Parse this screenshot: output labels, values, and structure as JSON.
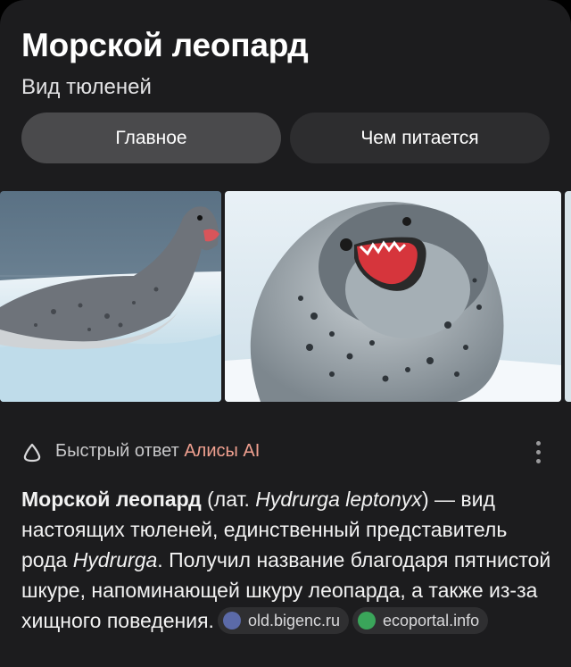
{
  "header": {
    "title": "Морской леопард",
    "subtitle": "Вид тюленей"
  },
  "tabs": [
    {
      "label": "Главное",
      "active": true
    },
    {
      "label": "Чем питается",
      "active": false
    }
  ],
  "gallery": {
    "images": [
      "leopard-seal-on-ice-profile",
      "leopard-seal-open-mouth-closeup"
    ]
  },
  "alice": {
    "label_prefix": "Быстрый ответ",
    "label_accent": "Алисы AI",
    "accent_color": "#f0a090"
  },
  "answer": {
    "bold_name": "Морской леопард",
    "part1": " (лат. ",
    "latin": "Hydrurga leptonyx",
    "part2": ") — вид настоящих тюленей, единственный представитель рода ",
    "genus": "Hydrurga",
    "part3": ". Получил название благодаря пятнистой шкуре, напоминающей шкуру леопарда, а также из-за хищного поведения.",
    "sources": [
      {
        "label": "old.bigenc.ru",
        "icon": "bigenc-icon"
      },
      {
        "label": "ecoportal.info",
        "icon": "leaf-icon"
      }
    ]
  },
  "colors": {
    "background": "#1c1c1e",
    "tab_active": "#4a4a4c",
    "tab_inactive": "#2d2d2f",
    "chip": "#2f2f31"
  }
}
